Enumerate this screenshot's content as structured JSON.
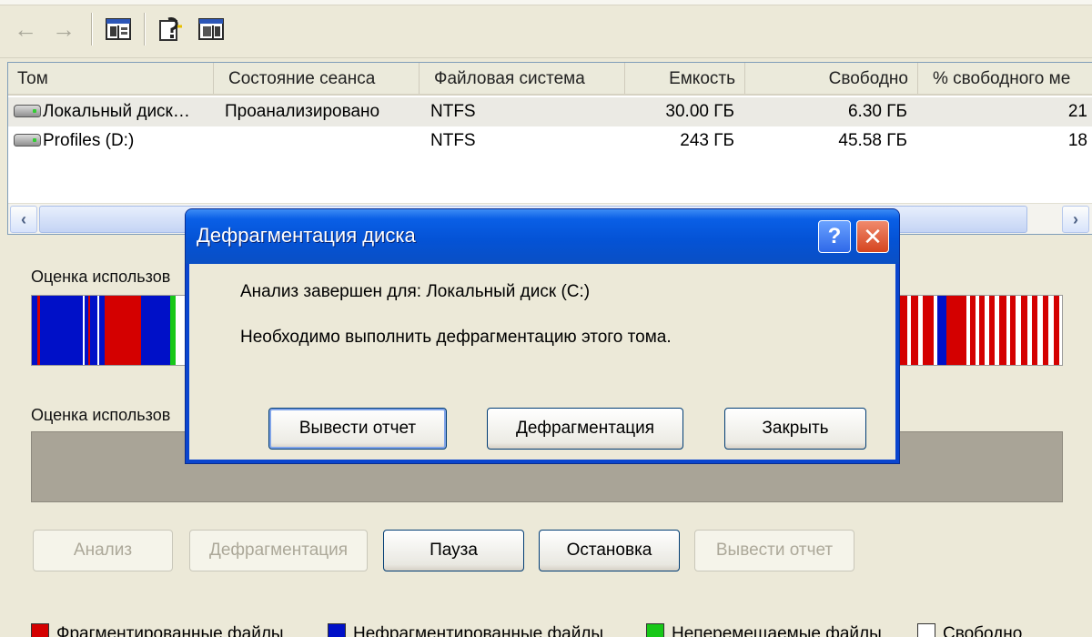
{
  "toolbar": {
    "back_icon": "back-arrow-icon",
    "forward_icon": "forward-arrow-icon",
    "buttons": [
      "console-tree-icon",
      "help-icon",
      "action-pane-icon"
    ]
  },
  "volumes": {
    "columns": [
      "Том",
      "Состояние сеанса",
      "Файловая система",
      "Емкость",
      "Свободно",
      "% свободного ме"
    ],
    "rows": [
      {
        "name": "Локальный диск…",
        "status": "Проанализировано",
        "fs": "NTFS",
        "capacity": "30.00 ГБ",
        "free": "6.30 ГБ",
        "pct": "21"
      },
      {
        "name": "Profiles (D:)",
        "status": "",
        "fs": "NTFS",
        "capacity": "243 ГБ",
        "free": "45.58 ГБ",
        "pct": "18"
      }
    ]
  },
  "estimate_before_label": "Оценка использов",
  "estimate_after_label": "Оценка использов",
  "colors": {
    "fragmented": "#d40000",
    "contiguous": "#0010c8",
    "unmovable": "#18c818",
    "free": "#ffffff"
  },
  "buttons": {
    "analyze": "Анализ",
    "defrag": "Дефрагментация",
    "pause": "Пауза",
    "stop": "Остановка",
    "report": "Вывести отчет"
  },
  "legend": {
    "fragmented": "Фрагментированные файлы",
    "contiguous": "Нефрагментированные файлы",
    "unmovable": "Неперемещаемые файлы",
    "free": "Свободно"
  },
  "dialog": {
    "title": "Дефрагментация диска",
    "help": "?",
    "close": "✕",
    "line1": "Анализ завершен для: Локальный диск (C:)",
    "line2": "Необходимо выполнить дефрагментацию этого тома.",
    "btn_report": "Вывести отчет",
    "btn_defrag": "Дефрагментация",
    "btn_close": "Закрыть"
  }
}
